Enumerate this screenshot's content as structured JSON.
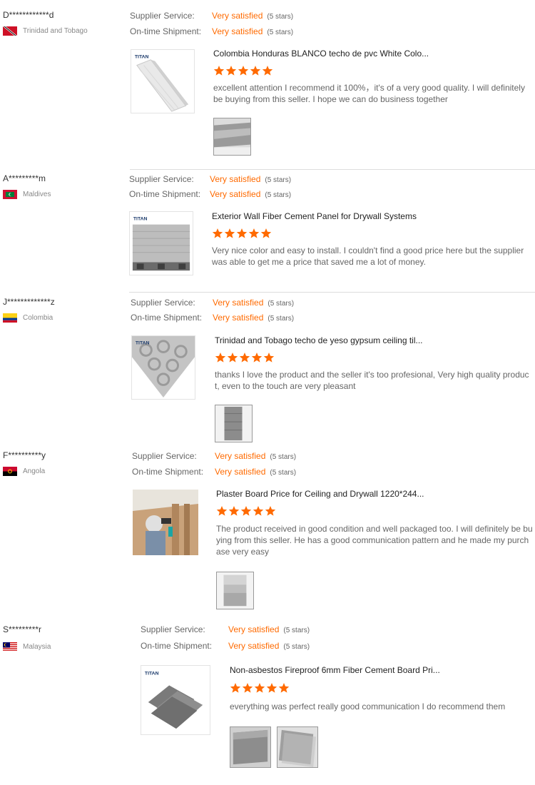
{
  "reviews": [
    {
      "buyer": "D************d",
      "country": "Trinidad and Tobago",
      "supplier_service_label": "Supplier Service:",
      "supplier_service_value": "Very satisfied",
      "supplier_service_stars": "(5 stars)",
      "shipment_label": "On-time Shipment:",
      "shipment_value": "Very satisfied",
      "shipment_stars": "(5 stars)",
      "product_title": "Colombia Honduras BLANCO techo de pvc White Colo...",
      "rating": 5,
      "text": "excellent attention I recommend it 100%，it's of a very good quality. I will definitely be buying from this seller. I hope we can do business together"
    },
    {
      "buyer": "A*********m",
      "country": "Maldives",
      "supplier_service_label": "Supplier Service:",
      "supplier_service_value": "Very satisfied",
      "supplier_service_stars": "(5 stars)",
      "shipment_label": "On-time Shipment:",
      "shipment_value": "Very satisfied",
      "shipment_stars": "(5 stars)",
      "product_title": "Exterior Wall Fiber Cement Panel for Drywall Systems",
      "rating": 5,
      "text": "Very nice color and easy to install. I couldn't find a good price here but the supplier was able to get me a price that saved me a lot of money."
    },
    {
      "buyer": "J*************z",
      "country": "Colombia",
      "supplier_service_label": "Supplier Service:",
      "supplier_service_value": "Very satisfied",
      "supplier_service_stars": "(5 stars)",
      "shipment_label": "On-time Shipment:",
      "shipment_value": "Very satisfied",
      "shipment_stars": "(5 stars)",
      "product_title": "Trinidad and Tobago techo de yeso gypsum ceiling til...",
      "rating": 5,
      "text": "thanks I love the product and the seller it's too profesional, Very high quality product, even to the touch are very pleasant"
    },
    {
      "buyer": "F**********y",
      "country": "Angola",
      "supplier_service_label": "Supplier Service:",
      "supplier_service_value": "Very satisfied",
      "supplier_service_stars": "(5 stars)",
      "shipment_label": "On-time Shipment:",
      "shipment_value": "Very satisfied",
      "shipment_stars": "(5 stars)",
      "product_title": "Plaster Board Price for Ceiling and Drywall 1220*244...",
      "rating": 5,
      "text": "The product received in good condition and well packaged too. I will definitely be buying from this seller. He has a good communication pattern and he made my purchase very easy"
    },
    {
      "buyer": "S*********r",
      "country": "Malaysia",
      "supplier_service_label": "Supplier Service:",
      "supplier_service_value": "Very satisfied",
      "supplier_service_stars": "(5 stars)",
      "shipment_label": "On-time Shipment:",
      "shipment_value": "Very satisfied",
      "shipment_stars": "(5 stars)",
      "product_title": "Non-asbestos Fireproof 6mm Fiber Cement Board Pri...",
      "rating": 5,
      "text": "everything was perfect really good communication I do recommend them"
    }
  ],
  "logo_text": "TITAN",
  "colors": {
    "accent": "#ff6a00",
    "label": "#666666",
    "divider": "#dddddd"
  }
}
